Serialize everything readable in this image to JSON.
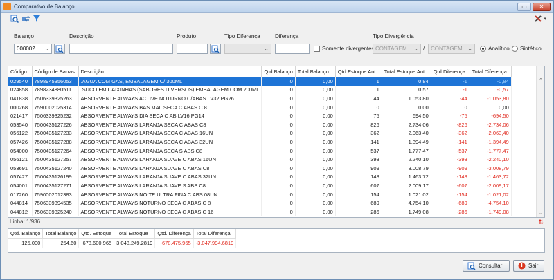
{
  "window": {
    "title": "Comparativo de Balanço",
    "min": "▭",
    "close": "✕"
  },
  "filters": {
    "balanco_label": "Balanço",
    "balanco_value": "000002",
    "descricao_label": "Descrição",
    "descricao_value": "",
    "produto_label": "Produto",
    "produto_value": "",
    "tipo_diferenca_label": "Tipo Diferença",
    "tipo_diferenca_value": "",
    "diferenca_label": "Diferença",
    "diferenca_value": "",
    "somente_divergentes_label": "Somente divergentes",
    "tipo_divergencia_label": "Tipo Divergência",
    "contagem1": "CONTAGEM",
    "separator": "/",
    "contagem2": "CONTAGEM",
    "analitico_label": "Analítico",
    "sintetico_label": "Sintético"
  },
  "grid": {
    "headers": [
      "Código",
      "Código de Barras",
      "Descrição",
      "Qtd Balanço",
      "Total Balanço",
      "Qtd Estoque Ant.",
      "Total Estoque Ant.",
      "Qtd Diferença",
      "Total Diferença"
    ],
    "rows": [
      [
        "029540",
        "7898945356053",
        ".AGUA COM GAS, EMBALAGEM C/ 300ML",
        "0",
        "0,00",
        "1",
        "0,84",
        "-1",
        "-0,84"
      ],
      [
        "024858",
        "7898234880511",
        ".SUCO EM CAIXINHAS (SABORES DIVERSOS) EMBALAGEM COM 200ML",
        "0",
        "0,00",
        "1",
        "0,57",
        "-1",
        "-0,57"
      ],
      [
        "041838",
        "7506339325263",
        "ABSORVENTE ALWAYS ACTIVE NOTURNO C/ABAS LV32 PG26",
        "0",
        "0,00",
        "44",
        "1.053,80",
        "-44",
        "-1.053,80"
      ],
      [
        "000268",
        "7590002025314",
        "ABSORVENTE ALWAYS BAS.MAL.SECA C ABAS C 8",
        "0",
        "0,00",
        "0",
        "0,00",
        "0",
        "0,00"
      ],
      [
        "021417",
        "7506339325232",
        "ABSORVENTE ALWAYS DIA SECA C AB LV16 PG14",
        "0",
        "0,00",
        "75",
        "694,50",
        "-75",
        "-694,50"
      ],
      [
        "053540",
        "7500435127226",
        "ABSORVENTE ALWAYS LARANJA SECA C ABAS C8",
        "0",
        "0,00",
        "826",
        "2.734,06",
        "-826",
        "-2.734,06"
      ],
      [
        "056122",
        "7500435127233",
        "ABSORVENTE ALWAYS LARANJA SECA C ABAS 16UN",
        "0",
        "0,00",
        "362",
        "2.063,40",
        "-362",
        "-2.063,40"
      ],
      [
        "057426",
        "7500435127288",
        "ABSORVENTE ALWAYS LARANJA SECA C ABAS 32UN",
        "0",
        "0,00",
        "141",
        "1.394,49",
        "-141",
        "-1.394,49"
      ],
      [
        "054000",
        "7500435127264",
        "ABSORVENTE ALWAYS LARANJA SECA S ABS C8",
        "0",
        "0,00",
        "537",
        "1.777,47",
        "-537",
        "-1.777,47"
      ],
      [
        "056121",
        "7500435127257",
        "ABSORVENTE ALWAYS LARANJA SUAVE C ABAS 16UN",
        "0",
        "0,00",
        "393",
        "2.240,10",
        "-393",
        "-2.240,10"
      ],
      [
        "053691",
        "7500435127240",
        "ABSORVENTE ALWAYS LARANJA SUAVE C ABAS C8",
        "0",
        "0,00",
        "909",
        "3.008,79",
        "-909",
        "-3.008,79"
      ],
      [
        "057427",
        "7500435126199",
        "ABSORVENTE ALWAYS LARANJA SUAVE C ABAS 32UN",
        "0",
        "0,00",
        "148",
        "1.463,72",
        "-148",
        "-1.463,72"
      ],
      [
        "054001",
        "7500435127271",
        "ABSORVENTE ALWAYS LARANJA SUAVE S ABS C8",
        "0",
        "0,00",
        "607",
        "2.009,17",
        "-607",
        "-2.009,17"
      ],
      [
        "017260",
        "7590002012383",
        "ABSORVENTE ALWAYS NOITE ULTRA FINA C ABS 08UN",
        "0",
        "0,00",
        "154",
        "1.021,02",
        "-154",
        "-1.021,02"
      ],
      [
        "044814",
        "7506339394535",
        "ABSORVENTE ALWAYS NOTURNO SECA C ABAS C 8",
        "0",
        "0,00",
        "689",
        "4.754,10",
        "-689",
        "-4.754,10"
      ],
      [
        "044812",
        "7506339325240",
        "ABSORVENTE ALWAYS NOTURNO SECA C ABAS C 16",
        "0",
        "0,00",
        "286",
        "1.749,08",
        "-286",
        "-1.749,08"
      ]
    ]
  },
  "status": {
    "linha": "Linha: 1/936"
  },
  "totals": {
    "headers": [
      "Qtd. Balanço",
      "Total Balanço",
      "Qtd. Estoque",
      "Total Estoque",
      "Qtd. Diferença",
      "Total Diferença"
    ],
    "values": [
      "125,000",
      "254,60",
      "678.600,965",
      "3.048.249,2819",
      "-678.475,965",
      "-3.047.994,6819"
    ]
  },
  "buttons": {
    "consultar": "Consultar",
    "sair": "Sair"
  },
  "colors": {
    "selection": "#1e74d6",
    "negative": "#e0281d",
    "accent": "#f08a24"
  }
}
